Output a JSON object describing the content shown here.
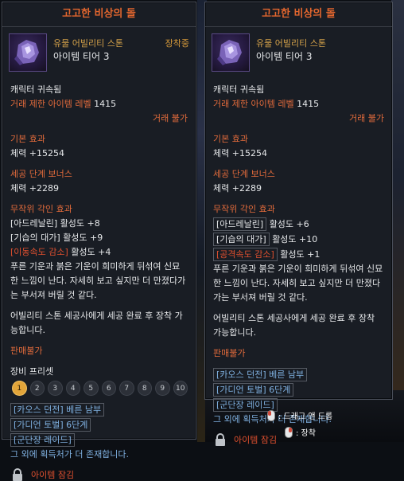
{
  "left": {
    "title": "고고한 비상의 돌",
    "rarity": "유물 어빌리티 스톤",
    "tier": "아이템 티어 3",
    "equipped": "장착중",
    "bound": "캐릭터 귀속됨",
    "trade_level_label": "거래 제한 아이템 레벨",
    "trade_level_value": "1415",
    "trade": "거래 불가",
    "basic_label": "기본 효과",
    "basic_value": "체력 +15254",
    "bonus_label": "세공 단계 보너스",
    "bonus_value": "체력 +2289",
    "engrave_label": "무작위 각인 효과",
    "engravings": [
      {
        "name": "[아드레날린]",
        "value": "활성도 +8"
      },
      {
        "name": "[기습의 대가]",
        "value": "활성도 +9"
      },
      {
        "name": "[이동속도 감소]",
        "value": "활성도 +4"
      }
    ],
    "desc": "푸른 기운과 붉은 기운이 희미하게 뒤섞여 신묘한 느낌이 난다. 자세히 보고 싶지만 더 만졌다가는 부서져 버릴 것 같다.",
    "craft_note": "어빌리티 스톤 세공사에게 세공 완료 후 장착 가능합니다.",
    "sell": "판매불가",
    "preset_label": "장비 프리셋",
    "presets": [
      "1",
      "2",
      "3",
      "4",
      "5",
      "6",
      "7",
      "8",
      "9",
      "10"
    ],
    "sources": [
      "[카오스 던전] 베른 남부",
      "[가디언 토벌] 6단계",
      "[군단장 레이드]",
      "그 외에 획득처가 더 존재합니다."
    ],
    "lock": "아이템 잠김"
  },
  "right": {
    "title": "고고한 비상의 돌",
    "rarity": "유물 어빌리티 스톤",
    "tier": "아이템 티어 3",
    "bound": "캐릭터 귀속됨",
    "trade_level_label": "거래 제한 아이템 레벨",
    "trade_level_value": "1415",
    "trade": "거래 불가",
    "basic_label": "기본 효과",
    "basic_value": "체력 +15254",
    "bonus_label": "세공 단계 보너스",
    "bonus_value": "체력 +2289",
    "engrave_label": "무작위 각인 효과",
    "engravings": [
      {
        "name": "[아드레날린]",
        "value": "활성도 +6"
      },
      {
        "name": "[기습의 대가]",
        "value": "활성도 +10"
      },
      {
        "name": "[공격속도 감소]",
        "value": "활성도 +1"
      }
    ],
    "desc": "푸른 기운과 붉은 기운이 희미하게 뒤섞여 신묘한 느낌이 난다. 자세히 보고 싶지만 더 만졌다가는 부서져 버릴 것 같다.",
    "craft_note": "어빌리티 스톤 세공사에게 세공 완료 후 장착 가능합니다.",
    "sell": "판매불가",
    "sources": [
      "[카오스 던전] 베른 남부",
      "[가디언 토벌] 6단계",
      "[군단장 레이드]",
      "그 외에 획득처가 더 존재합니다."
    ],
    "lock": "아이템 잠김"
  },
  "hints": {
    "drag": ": 드래그 앤 드롭",
    "equip": ": 장착"
  }
}
